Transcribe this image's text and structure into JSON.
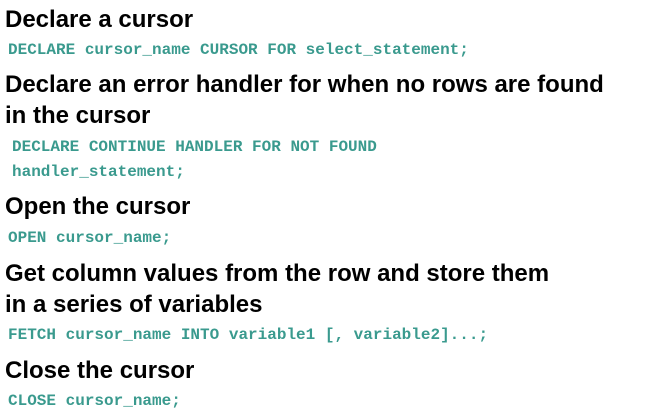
{
  "sections": [
    {
      "heading": "Declare a cursor",
      "code_lines": [
        "DECLARE cursor_name CURSOR FOR select_statement;"
      ]
    },
    {
      "heading_lines": [
        "Declare an error handler for when no rows are found",
        "in the cursor"
      ],
      "code_lines": [
        "DECLARE CONTINUE HANDLER FOR NOT FOUND",
        "handler_statement;"
      ]
    },
    {
      "heading": "Open the cursor",
      "code_lines": [
        "OPEN cursor_name;"
      ]
    },
    {
      "heading_lines": [
        "Get column values from the row and store them",
        "in a series of variables"
      ],
      "code_lines": [
        "FETCH cursor_name INTO variable1 [, variable2]...;"
      ]
    },
    {
      "heading": "Close the cursor",
      "code_lines": [
        "CLOSE cursor_name;"
      ]
    }
  ],
  "colors": {
    "heading": "#000000",
    "code": "#3a9a8e"
  }
}
